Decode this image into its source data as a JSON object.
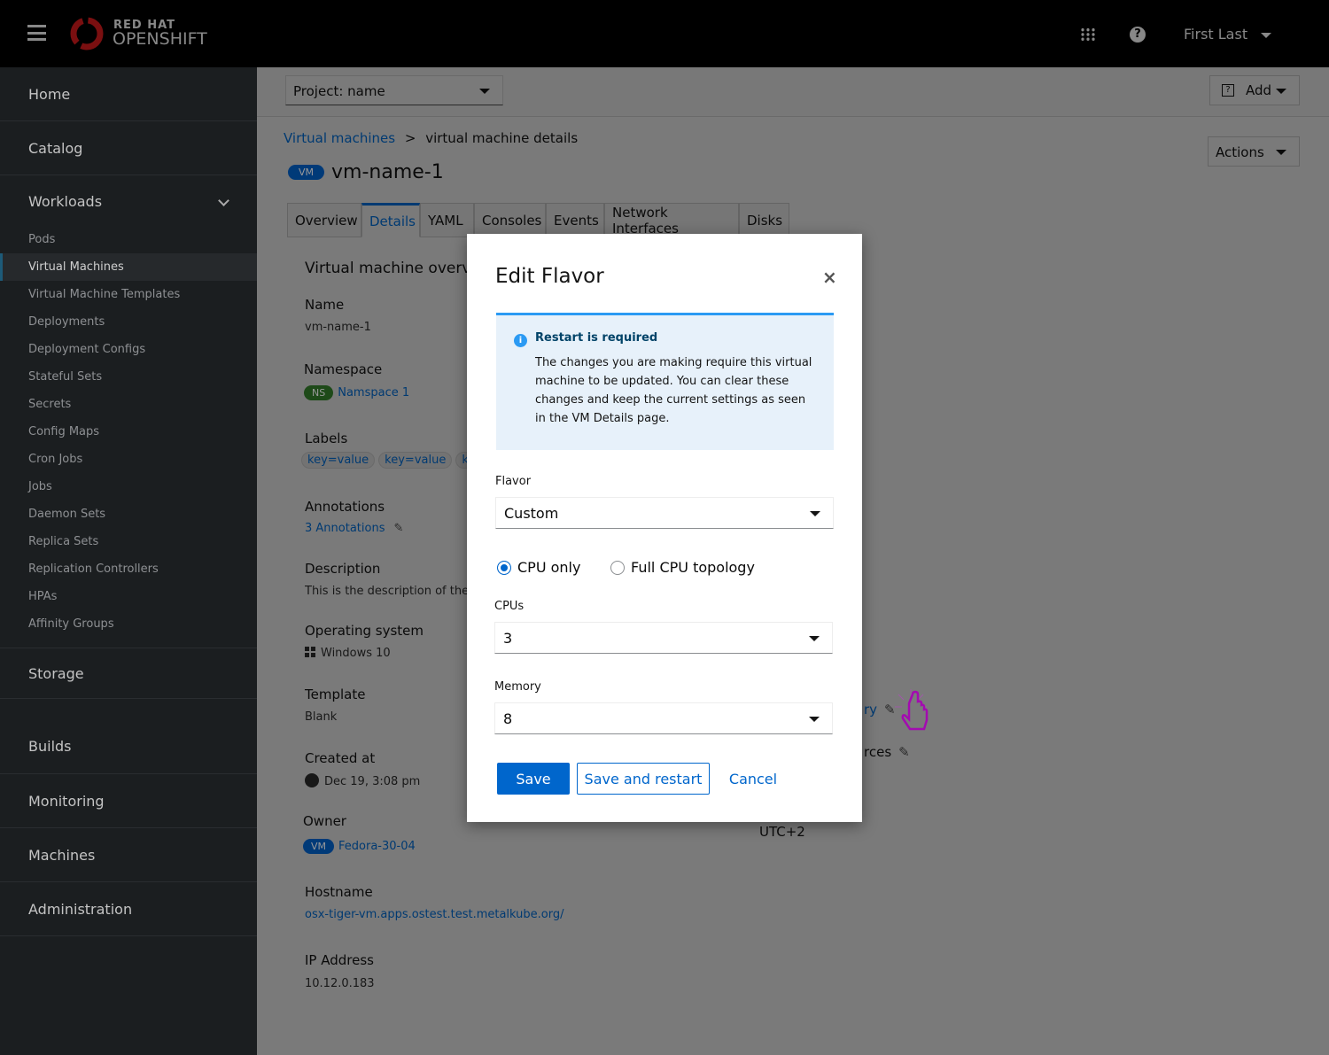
{
  "masthead": {
    "brand_top": "RED HAT",
    "brand_bottom": "OPENSHIFT",
    "user": "First Last"
  },
  "sidebar": {
    "sections": [
      {
        "label": "Home"
      },
      {
        "label": "Catalog"
      },
      {
        "label": "Workloads"
      },
      {
        "label": "Storage"
      },
      {
        "label": "Builds"
      },
      {
        "label": "Monitoring"
      },
      {
        "label": "Machines"
      },
      {
        "label": "Administration"
      }
    ],
    "workloads_items": [
      "Pods",
      "Virtual Machines",
      "Virtual Machine Templates",
      "Deployments",
      "Deployment Configs",
      "Stateful Sets",
      "Secrets",
      "Config Maps",
      "Cron Jobs",
      "Jobs",
      "Daemon Sets",
      "Replica Sets",
      "Replication Controllers",
      "HPAs",
      "Affinity Groups"
    ],
    "active_item": "Virtual Machines"
  },
  "toolbar": {
    "project": "Project: name",
    "add": "Add",
    "actions": "Actions"
  },
  "breadcrumb": {
    "parent": "Virtual machines",
    "sep": ">",
    "current": "virtual machine details"
  },
  "title": {
    "badge": "VM",
    "name": "vm-name-1"
  },
  "tabs": [
    "Overview",
    "Details",
    "YAML",
    "Consoles",
    "Events",
    "Network Interfaces",
    "Disks"
  ],
  "active_tab": "Details",
  "details": {
    "section_title": "Virtual machine overview",
    "name_label": "Name",
    "name": "vm-name-1",
    "namespace_label": "Namespace",
    "namespace_badge": "NS",
    "namespace": "Namspace 1",
    "labels_label": "Labels",
    "labels": [
      "key=value",
      "key=value",
      "key=value"
    ],
    "annotations_label": "Annotations",
    "annotations": "3 Annotations",
    "description_label": "Description",
    "description": "This is the description of the virtual machine",
    "os_label": "Operating system",
    "os": "Windows 10",
    "template_label": "Template",
    "template": "Blank",
    "created_label": "Created at",
    "created": "Dec 19, 3:08 pm",
    "owner_label": "Owner",
    "owner_badge": "VM",
    "owner": "Fedora-30-04",
    "hostname_label": "Hostname",
    "hostname": "osx-tiger-vm.apps.ostest.test.metalkube.org/",
    "ip_label": "IP Address",
    "ip": "10.12.0.183",
    "right_frag1": "ry",
    "right_frag2": "rces",
    "right_frag3": "UTC+2"
  },
  "modal": {
    "title": "Edit Flavor",
    "alert_title": "Restart is required",
    "alert_body": "The changes you are making require this virtual machine to be updated. You can clear these changes and keep the current settings as seen in the VM Details page.",
    "flavor_label": "Flavor",
    "flavor": "Custom",
    "radio_cpu_only": "CPU only",
    "radio_full": "Full CPU topology",
    "selected_radio": "CPU only",
    "cpus_label": "CPUs",
    "cpus": "3",
    "memory_label": "Memory",
    "memory": "8",
    "save": "Save",
    "save_restart": "Save and restart",
    "cancel": "Cancel"
  },
  "colors": {
    "primary": "#0066cc",
    "alert_bg": "#e7f1fa",
    "alert_border": "#2b9af3",
    "cursor": "#a30bb0",
    "brand_red": "#c00"
  }
}
